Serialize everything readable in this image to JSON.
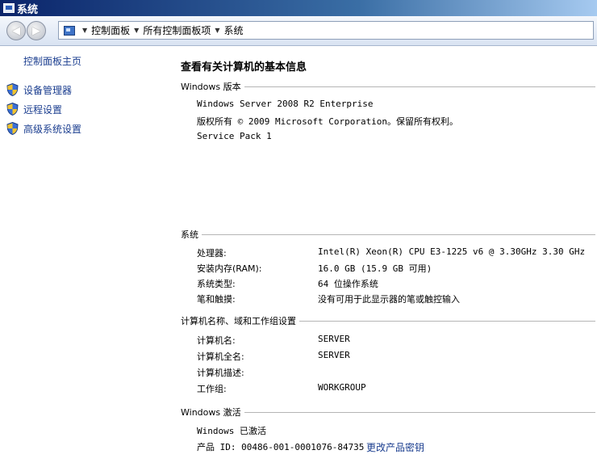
{
  "window": {
    "title": "系统"
  },
  "navigation": {
    "back_label": "◀",
    "forward_label": "▶",
    "breadcrumbs": [
      "控制面板",
      "所有控制面板项",
      "系统"
    ]
  },
  "sidebar": {
    "home_link": "控制面板主页",
    "tasks": [
      {
        "label": "设备管理器",
        "icon": "uac-shield-icon"
      },
      {
        "label": "远程设置",
        "icon": "uac-shield-icon"
      },
      {
        "label": "高级系统设置",
        "icon": "uac-shield-icon"
      }
    ]
  },
  "main": {
    "title": "查看有关计算机的基本信息",
    "edition": {
      "header": "Windows 版本",
      "name": "Windows Server 2008 R2 Enterprise",
      "copyright": "版权所有 © 2009 Microsoft Corporation。保留所有权利。",
      "service_pack": "Service Pack 1"
    },
    "system": {
      "header": "系统",
      "rows": [
        {
          "key": "处理器:",
          "value": "Intel(R) Xeon(R) CPU E3-1225 v6 @ 3.30GHz   3.30 GHz"
        },
        {
          "key": "安装内存(RAM):",
          "value": "16.0 GB (15.9 GB 可用)"
        },
        {
          "key": "系统类型:",
          "value": "64 位操作系统"
        },
        {
          "key": "笔和触摸:",
          "value": "没有可用于此显示器的笔或触控输入"
        }
      ]
    },
    "computer": {
      "header": "计算机名称、域和工作组设置",
      "rows": [
        {
          "key": "计算机名:",
          "value": "SERVER"
        },
        {
          "key": "计算机全名:",
          "value": "SERVER"
        },
        {
          "key": "计算机描述:",
          "value": ""
        },
        {
          "key": "工作组:",
          "value": "WORKGROUP"
        }
      ]
    },
    "activation": {
      "header": "Windows 激活",
      "status": "Windows 已激活",
      "product_id": "产品 ID: 00486-001-0001076-84735",
      "change_key_link": "更改产品密钥"
    }
  },
  "colors": {
    "link": "#1a3d8f",
    "titlebar": "#0a246a"
  }
}
